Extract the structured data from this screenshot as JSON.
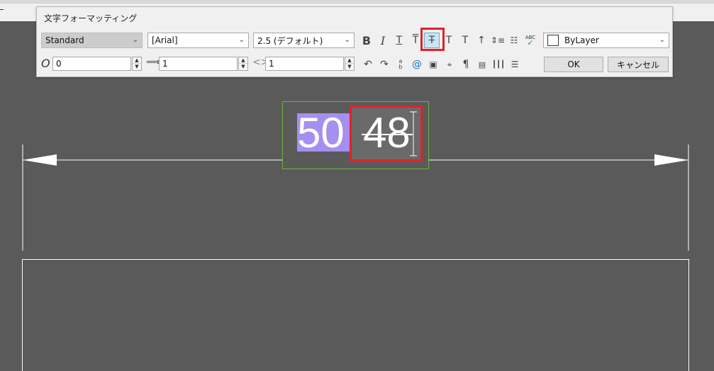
{
  "dialog": {
    "title": "文字フォーマッティング",
    "style_combo": "Standard",
    "font_combo": "[Arial]",
    "height_combo": "2.5 (デフォルト)",
    "color_combo": "ByLayer",
    "oblique_value": "0",
    "tracking_value": "1",
    "width_value": "1",
    "ok_label": "OK",
    "cancel_label": "キャンセル",
    "oblique_label": "O"
  },
  "toolbar": {
    "bold": "B",
    "italic": "I",
    "underline": "T",
    "overline": "T",
    "strikethrough": "T",
    "superscript": "T",
    "subscript": "T",
    "at_symbol": "@",
    "spellcheck": "ABC",
    "stack_a": "a",
    "stack_b": "b"
  },
  "editor": {
    "selected_text": "50",
    "text": "48"
  }
}
